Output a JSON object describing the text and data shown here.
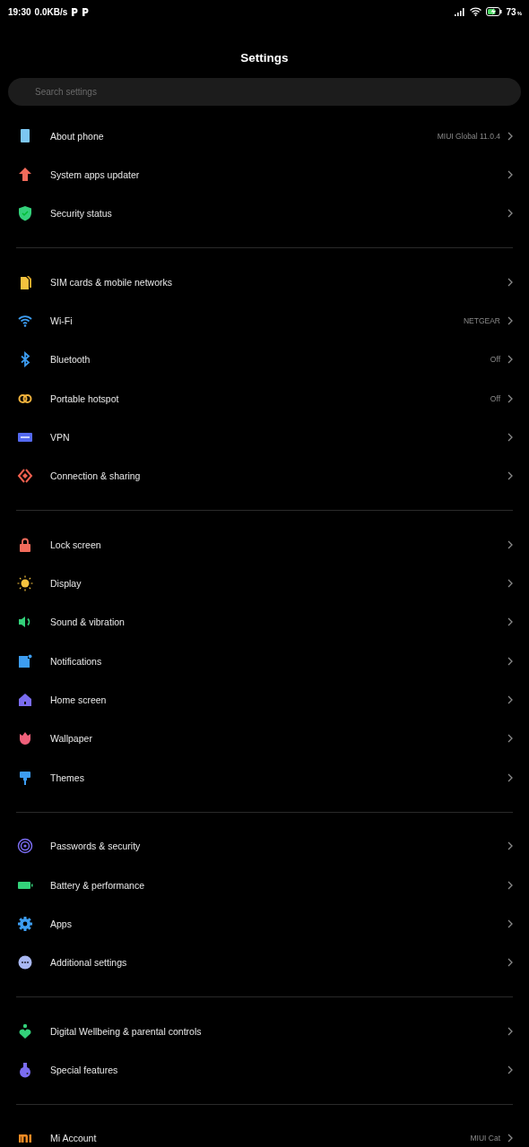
{
  "status_bar": {
    "time": "19:30",
    "speed": "0.0KB/s",
    "battery": "73",
    "battery_unit": "%",
    "charging": true
  },
  "title": "Settings",
  "search": {
    "placeholder": "Search settings"
  },
  "groups": [
    {
      "items": [
        {
          "label": "About phone",
          "value": "MIUI Global 11.0.4"
        },
        {
          "label": "System apps updater"
        },
        {
          "label": "Security status"
        }
      ]
    },
    {
      "items": [
        {
          "label": "SIM cards & mobile networks"
        },
        {
          "label": "Wi-Fi",
          "value": "NETGEAR"
        },
        {
          "label": "Bluetooth",
          "value": "Off"
        },
        {
          "label": "Portable hotspot",
          "value": "Off"
        },
        {
          "label": "VPN"
        },
        {
          "label": "Connection & sharing"
        }
      ]
    },
    {
      "items": [
        {
          "label": "Lock screen"
        },
        {
          "label": "Display"
        },
        {
          "label": "Sound & vibration"
        },
        {
          "label": "Notifications"
        },
        {
          "label": "Home screen"
        },
        {
          "label": "Wallpaper"
        },
        {
          "label": "Themes"
        }
      ]
    },
    {
      "items": [
        {
          "label": "Passwords & security"
        },
        {
          "label": "Battery & performance"
        },
        {
          "label": "Apps"
        },
        {
          "label": "Additional settings"
        }
      ]
    },
    {
      "items": [
        {
          "label": "Digital Wellbeing & parental controls"
        },
        {
          "label": "Special features"
        }
      ]
    },
    {
      "items": [
        {
          "label": "Mi Account",
          "value": "MIUI Cat"
        }
      ]
    }
  ]
}
